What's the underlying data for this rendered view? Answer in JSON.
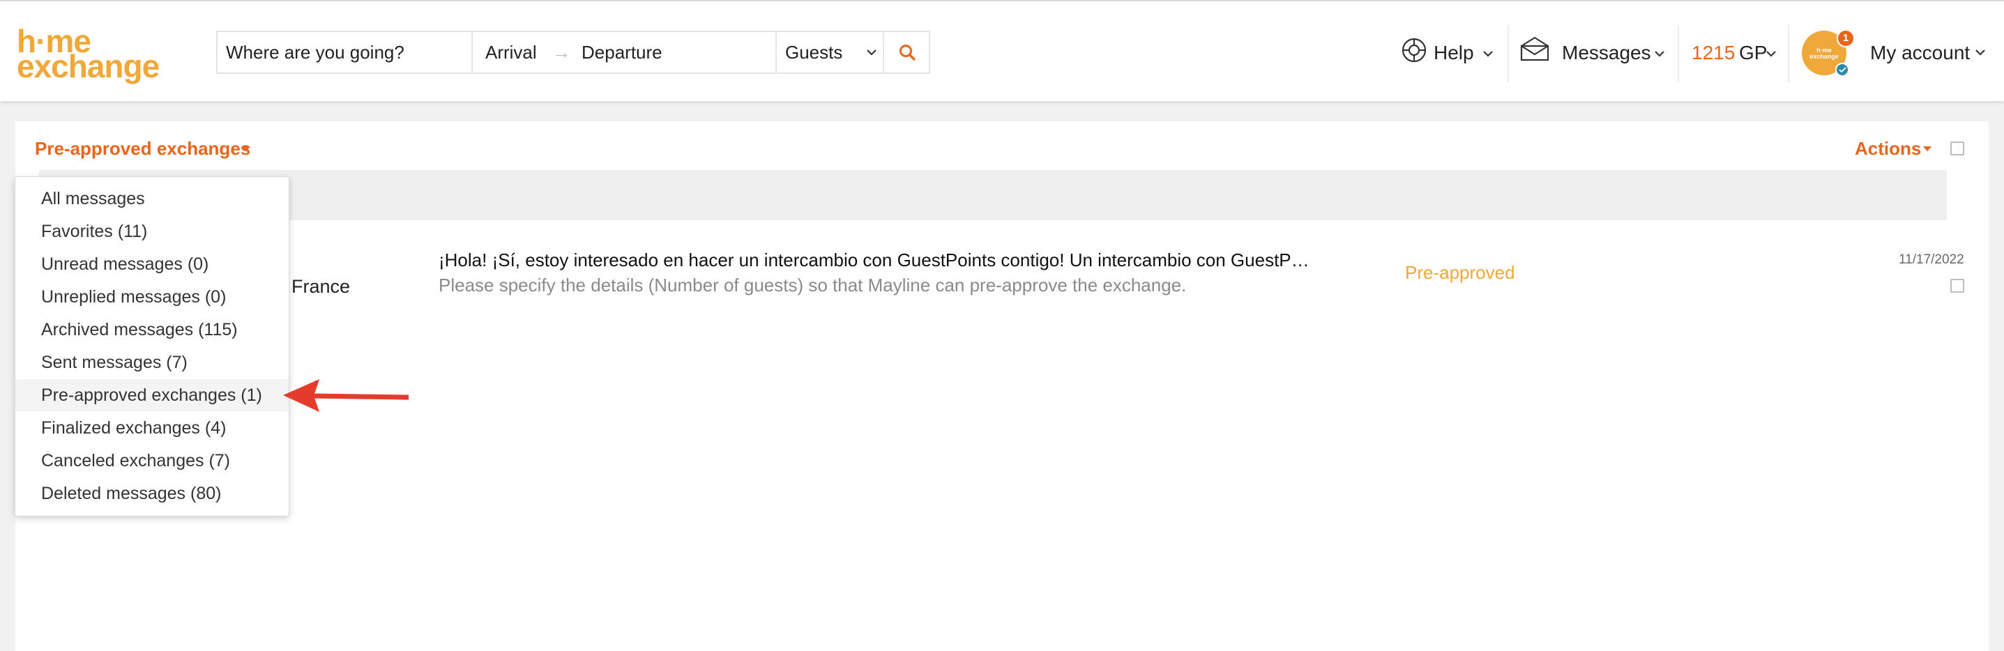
{
  "brand": {
    "logo_line1": "h·me",
    "logo_line2": "exchange",
    "orange": "#e8661c",
    "gold": "#f0a83a"
  },
  "search": {
    "destination_placeholder": "Where are you going?",
    "arrival": "Arrival",
    "arrow": "→",
    "departure": "Departure",
    "guests": "Guests",
    "submit_icon": "search-icon"
  },
  "nav": {
    "help": "Help",
    "messages": "Messages",
    "points_value": "1215",
    "points_unit": "GP",
    "account": "My account",
    "notification_count": "1",
    "avatar_text": "h·me exchange"
  },
  "toolbar": {
    "filter_label": "Pre-approved exchanges",
    "actions_label": "Actions"
  },
  "message": {
    "sender_fragment": "France",
    "preview_line1": "¡Hola! ¡Sí, estoy interesado en hacer un intercambio con GuestPoints contigo! Un intercambio con GuestP…",
    "preview_line2": "Please specify the details (Number of guests) so that Mayline can pre-approve the exchange.",
    "status": "Pre-approved",
    "date": "11/17/2022"
  },
  "dropdown": {
    "items": [
      {
        "label": "All messages"
      },
      {
        "label": "Favorites (11)"
      },
      {
        "label": "Unread messages (0)"
      },
      {
        "label": "Unreplied messages (0)"
      },
      {
        "label": "Archived messages (115)"
      },
      {
        "label": "Sent messages (7)"
      },
      {
        "label": "Pre-approved exchanges (1)"
      },
      {
        "label": "Finalized exchanges (4)"
      },
      {
        "label": "Canceled exchanges (7)"
      },
      {
        "label": "Deleted messages (80)"
      }
    ],
    "active_index": 6
  },
  "annotation": {
    "arrow_color": "#e53b2c"
  }
}
